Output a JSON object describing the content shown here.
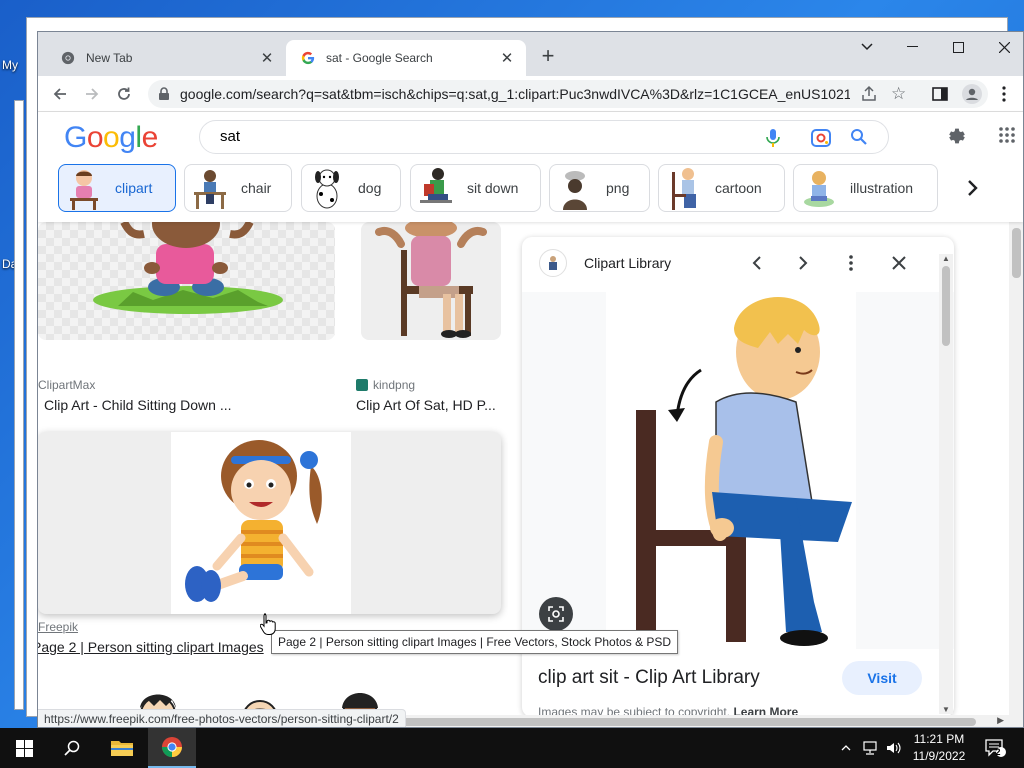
{
  "desktop": {
    "labels": [
      "My",
      "Da"
    ]
  },
  "browser": {
    "tabs": [
      {
        "title": "New Tab",
        "favicon": "chrome-icon",
        "active": false
      },
      {
        "title": "sat - Google Search",
        "favicon": "google-g-icon",
        "active": true
      }
    ],
    "url": "google.com/search?q=sat&tbm=isch&chips=q:sat,g_1:clipart:Puc3nwdIVCA%3D&rlz=1C1GCEA_enUS1021..."
  },
  "google": {
    "logo": "Google",
    "logo_colors": [
      "#4285f4",
      "#ea4335",
      "#fbbc05",
      "#4285f4",
      "#34a853",
      "#ea4335"
    ],
    "query": "sat",
    "chips": [
      {
        "label": "clipart",
        "selected": true
      },
      {
        "label": "chair",
        "selected": false
      },
      {
        "label": "dog",
        "selected": false
      },
      {
        "label": "sit down",
        "selected": false
      },
      {
        "label": "png",
        "selected": false
      },
      {
        "label": "cartoon",
        "selected": false
      },
      {
        "label": "illustration",
        "selected": false
      }
    ]
  },
  "results": [
    {
      "source": "ClipartMax",
      "title": "Clip Art - Child Sitting Down ..."
    },
    {
      "source": "kindpng",
      "title": "Clip Art Of Sat, HD P..."
    },
    {
      "source": "Freepik",
      "title": "Page 2 | Person sitting clipart Images"
    }
  ],
  "preview": {
    "site": "Clipart Library",
    "title": "clip art sit - Clip Art Library",
    "visit_label": "Visit",
    "note": "Images may be subject to copyright.",
    "learn_more": "Learn More"
  },
  "tooltip": "Page 2 | Person sitting clipart Images | Free Vectors, Stock Photos & PSD",
  "status_url": "https://www.freepik.com/free-photos-vectors/person-sitting-clipart/2",
  "taskbar": {
    "time": "11:21 PM",
    "date": "11/9/2022",
    "notification_count": "2"
  },
  "colors": {
    "accent": "#1a73e8",
    "chip_selected_bg": "#e8f0fe",
    "taskbar": "#101010",
    "desktop": "#1f74d8"
  }
}
